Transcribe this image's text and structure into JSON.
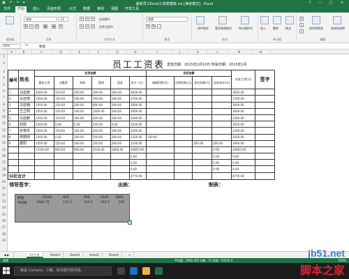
{
  "window": {
    "title": "最新员工Excel工资表模板.xls [兼容模式] - Excel",
    "controls": [
      "?",
      "─",
      "□",
      "✕"
    ]
  },
  "ribbon_tabs": [
    "文件",
    "开始",
    "插入",
    "页面布局",
    "公式",
    "数据",
    "审阅",
    "视图",
    "开发工具"
  ],
  "ribbon": {
    "clipboard_label": "剪贴板",
    "font_label": "字体",
    "align_label": "对齐方式",
    "number_label": "数字",
    "styles_label": "样式",
    "cells_label": "单元格",
    "edit_label": "编辑",
    "font_name": "宋体",
    "font_size": "12",
    "wrap_text": "自动换行",
    "merge": "合并后居中",
    "number_format": "常规",
    "cond_format": "条件格式",
    "table_format": "套用表格格式",
    "cell_styles": "单元格样式",
    "insert": "插入",
    "delete": "删除",
    "format": "格式",
    "sort_filter": "排序和筛选",
    "find_select": "查找和选择"
  },
  "formula_bar": {
    "name_box": "B20",
    "fx": "fx",
    "value": "和值"
  },
  "columns": [
    "A",
    "B",
    "C",
    "D",
    "E",
    "F",
    "G",
    "H",
    "I",
    "J",
    "K",
    "L",
    "M",
    "N"
  ],
  "rows": [
    "1",
    "2",
    "3",
    "4",
    "5",
    "6",
    "7",
    "8",
    "9",
    "10",
    "11",
    "12",
    "13",
    "14",
    "15",
    "16",
    "17",
    "18",
    "19",
    "20",
    "21",
    "22",
    "23",
    "24",
    "25",
    "26",
    "27",
    "28",
    "29"
  ],
  "sheet": {
    "title": "员工工资表",
    "issue_date": "发放日期：2015年2月10日 所属日期：2015年1月",
    "sign_label": "签字",
    "col_no": "编号",
    "col_name": "姓名",
    "group_payable": "应发金额",
    "group_deduct": "应扣金额",
    "sub_headers": [
      "基本工资",
      "全勤奖",
      "补助",
      "提成",
      "奖金",
      "合计（元）",
      "请假扣款(天)",
      "迟到扣款(元)",
      "其它扣款(元)",
      "应扣合计(元)",
      "实发工资(元)"
    ],
    "employees": [
      {
        "no": "1",
        "name": "马亚丽",
        "base": "3000.00",
        "att": "150.00",
        "sub": "100.00",
        "comm": "300.00",
        "bonus": "300.00",
        "total": "3850.00",
        "leave": "",
        "late": "",
        "other": "",
        "ded": "",
        "net": "3850.00"
      },
      {
        "no": "2",
        "name": "马亚南",
        "base": "1450.00",
        "att": "150.00",
        "sub": "100.00",
        "comm": "700.00",
        "bonus": "300.00",
        "total": "2700.00",
        "leave": "",
        "late": "",
        "other": "",
        "ded": "",
        "net": "2700.00"
      },
      {
        "no": "3",
        "name": "马亚楠",
        "base": "1450.00",
        "att": "150.00",
        "sub": "200.00",
        "comm": "900.00",
        "bonus": "300.00",
        "total": "3000.00",
        "leave": "",
        "late": "",
        "other": "",
        "ded": "",
        "net": "3000.00"
      },
      {
        "no": "4",
        "name": "王立明",
        "base": "1450.00",
        "att": "150.00",
        "sub": "100.00",
        "comm": "1000.00",
        "bonus": "300.00",
        "total": "3000.00",
        "leave": "",
        "late": "",
        "other": "",
        "ded": "",
        "net": "3000.00"
      },
      {
        "no": "5",
        "name": "马亚鹏",
        "base": "1450.00",
        "att": "150.00",
        "sub": "100.00",
        "comm": "400.00",
        "bonus": "300.00",
        "total": "2400.00",
        "leave": "",
        "late": "",
        "other": "",
        "ded": "",
        "net": "2400.00"
      },
      {
        "no": "6",
        "name": "邓倩",
        "base": "1450.00",
        "att": "0.00",
        "sub": "0.00",
        "comm": "200.00",
        "bonus": "0.00",
        "total": "1650.00",
        "leave": "",
        "late": "",
        "other": "",
        "ded": "",
        "net": "1650.00"
      },
      {
        "no": "7",
        "name": "张黎琴",
        "base": "1450.00",
        "att": "150.00",
        "sub": "100.00",
        "comm": "400.00",
        "bonus": "300.00",
        "total": "2400.00",
        "leave": "",
        "late": "",
        "other": "",
        "ded": "",
        "net": "2400.00"
      },
      {
        "no": "8",
        "name": "邢丽田",
        "base": "1450.00",
        "att": "0.00",
        "sub": "100.00",
        "comm": "500.00",
        "bonus": "300.00",
        "total": "2350.00",
        "leave": "330.00",
        "late": "",
        "other": "",
        "ded": "",
        "net": "2020.00"
      },
      {
        "no": "9",
        "name": "蕙阳",
        "base": "1450.00",
        "att": "150.00",
        "sub": "100.00",
        "comm": "100.00",
        "bonus": "300.00",
        "total": "2100.00",
        "leave": "",
        "late": "",
        "other": "200.00",
        "ded": "200.00",
        "net": "1900.00"
      },
      {
        "no": "",
        "name": "",
        "base": "13150.00",
        "att": "900.00",
        "sub": "900.00",
        "comm": "4100.00",
        "bonus": "1800.00",
        "total": "20850.00",
        "leave": "",
        "late": "",
        "other": "",
        "ded": "0.00",
        "net": "20850.00"
      },
      {
        "no": "",
        "name": "",
        "base": "",
        "att": "",
        "sub": "",
        "comm": "",
        "bonus": "",
        "total": "0.00",
        "leave": "",
        "late": "",
        "other": "",
        "ded": "0.00",
        "net": "0.00"
      },
      {
        "no": "",
        "name": "",
        "base": "",
        "att": "",
        "sub": "",
        "comm": "",
        "bonus": "",
        "total": "0.00",
        "leave": "",
        "late": "",
        "other": "",
        "ded": "0.00",
        "net": "0.00"
      },
      {
        "no": "",
        "name": "",
        "base": "",
        "att": "",
        "sub": "",
        "comm": "",
        "bonus": "",
        "total": "0.00",
        "leave": "",
        "late": "",
        "other": "",
        "ded": "0.00",
        "net": "0.00"
      }
    ],
    "subtotal_label": "分栏合计",
    "subtotal_total": "4770.00",
    "subtotal_net": "4770.00",
    "leader_sign": "领导签字：",
    "cashier": "出纳：",
    "preparer": "制表："
  },
  "selection_box": {
    "row1": [
      "和值",
      "13150",
      "900",
      "900",
      "4100",
      "1800"
    ],
    "row2": [
      "平均值",
      "1643.75",
      "112.5",
      "112.5",
      "512.5",
      "225"
    ]
  },
  "sheet_tabs": [
    "5月工资",
    "Sheet3",
    "Sheet4",
    "Sheet1",
    "Sheet2",
    "+"
  ],
  "status_bar": {
    "ready": "就绪",
    "count": "平均值：2941.425  计数：12  求和：23531.4",
    "zoom": "100%"
  },
  "taskbar": {
    "search_text": "我是 Cortana，小娜。有问题尽管问我。"
  },
  "watermark": {
    "site": "jb51.net",
    "name": "脚本之家"
  }
}
